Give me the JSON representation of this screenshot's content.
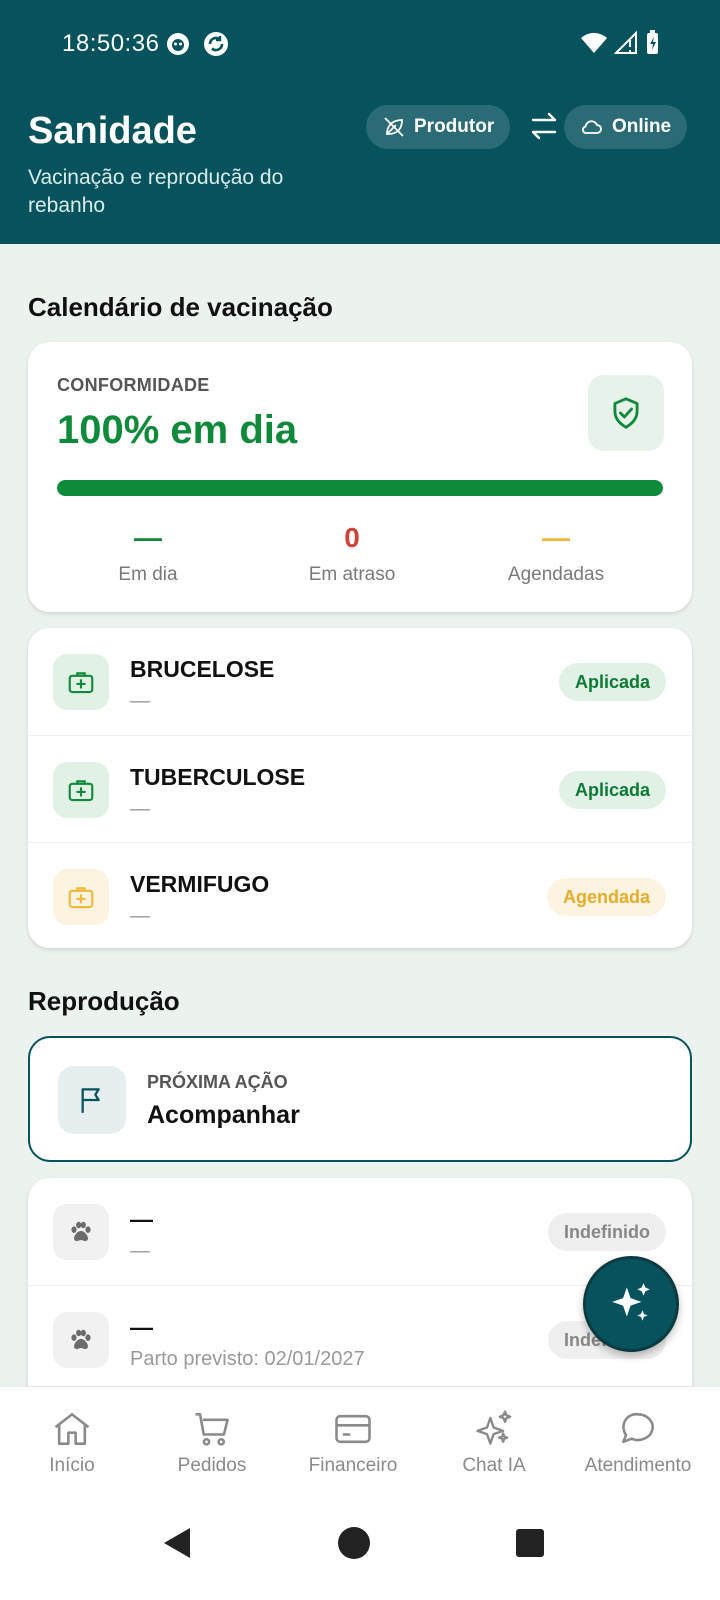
{
  "status_bar": {
    "time": "18:50:36"
  },
  "header": {
    "title": "Sanidade",
    "subtitle": "Vacinação e reprodução do rebanho",
    "chip_profile": "Produtor",
    "chip_status": "Online"
  },
  "vaccination": {
    "section_title": "Calendário de vacinação",
    "compliance_label": "CONFORMIDADE",
    "compliance_value": "100% em dia",
    "compliance_progress_percent": 100,
    "stats": [
      {
        "value": "—",
        "label": "Em dia",
        "color": "#0e8a3a"
      },
      {
        "value": "0",
        "label": "Em atraso",
        "color": "#d2423a"
      },
      {
        "value": "—",
        "label": "Agendadas",
        "color": "#f0b93a"
      }
    ],
    "items": [
      {
        "name": "BRUCELOSE",
        "detail": "—",
        "status": "Aplicada"
      },
      {
        "name": "TUBERCULOSE",
        "detail": "—",
        "status": "Aplicada"
      },
      {
        "name": "VERMIFUGO",
        "detail": "—",
        "status": "Agendada"
      }
    ]
  },
  "reproduction": {
    "section_title": "Reprodução",
    "next_action_label": "PRÓXIMA AÇÃO",
    "next_action_value": "Acompanhar",
    "items": [
      {
        "name": "—",
        "detail": "—",
        "status": "Indefinido"
      },
      {
        "name": "—",
        "detail": "Parto previsto: 02/01/2027",
        "status": "Indefinido"
      }
    ]
  },
  "bottom_nav": [
    {
      "label": "Início",
      "icon": "home-icon"
    },
    {
      "label": "Pedidos",
      "icon": "cart-icon"
    },
    {
      "label": "Financeiro",
      "icon": "card-icon"
    },
    {
      "label": "Chat IA",
      "icon": "sparkles-icon"
    },
    {
      "label": "Atendimento",
      "icon": "chat-bubble-icon"
    }
  ],
  "colors": {
    "header_bg": "#06525d",
    "success": "#0e8a3a",
    "danger": "#d2423a",
    "warning": "#f0b93a"
  }
}
